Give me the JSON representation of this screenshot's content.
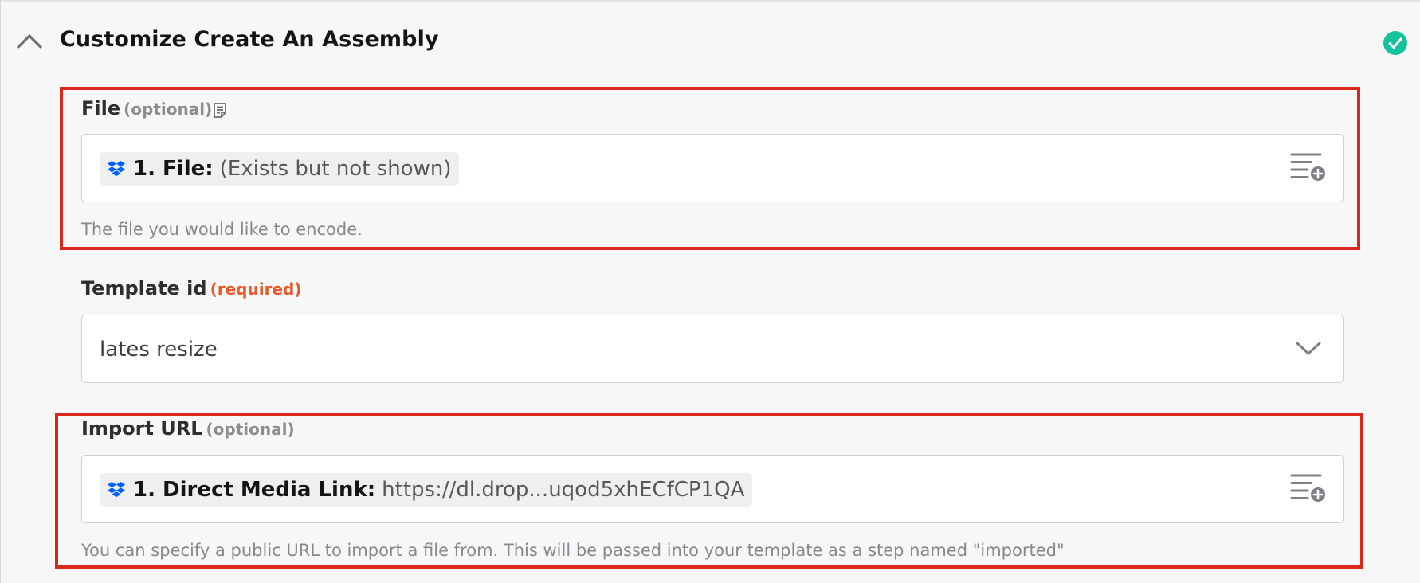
{
  "section": {
    "title": "Customize Create An Assembly",
    "collapse_icon": "chevron-up-icon",
    "status_icon": "check-circle-icon",
    "status_color": "#16c29b"
  },
  "fields": {
    "file": {
      "label": "File",
      "qualifier": "(optional)",
      "pill_key": "1. File:",
      "pill_value": "(Exists but not shown)",
      "help": "The file you would like to encode."
    },
    "template_id": {
      "label": "Template id",
      "qualifier": "(required)",
      "value": "lates resize"
    },
    "import_url": {
      "label": "Import URL",
      "qualifier": "(optional)",
      "pill_key": "1. Direct Media Link:",
      "pill_value": "https://dl.drop...uqod5xhECfCP1QA",
      "help": "You can specify a public URL to import a file from. This will be passed into your template as a step named \"imported\""
    }
  },
  "colors": {
    "highlight": "#d9271e",
    "required": "#e65a2b",
    "dropbox": "#0061fe"
  }
}
